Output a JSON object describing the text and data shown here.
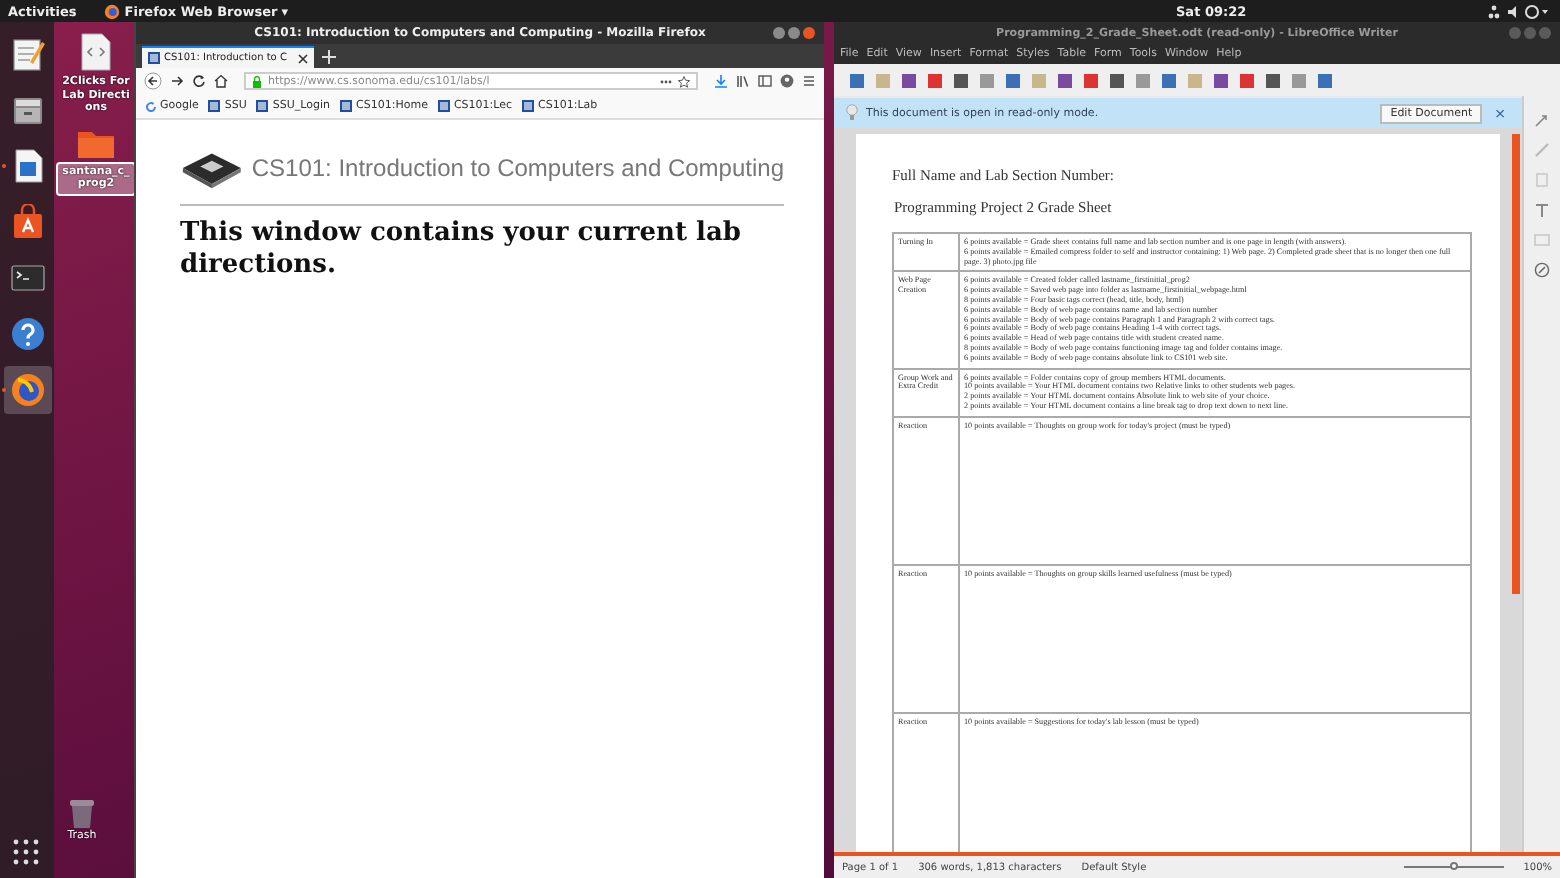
{
  "top_bar": {
    "activities": "Activities",
    "app_menu": "Firefox Web Browser",
    "app_menu_caret": "▾",
    "clock": "Sat 09:22"
  },
  "dock": [
    {
      "kind": "text-editor",
      "running": false,
      "selected": false
    },
    {
      "kind": "files",
      "running": false,
      "selected": false
    },
    {
      "kind": "writer",
      "running": true,
      "selected": false
    },
    {
      "kind": "software",
      "running": false,
      "selected": false
    },
    {
      "kind": "terminal",
      "running": false,
      "selected": false
    },
    {
      "kind": "help",
      "running": false,
      "selected": false
    },
    {
      "kind": "firefox",
      "running": true,
      "selected": true
    }
  ],
  "desktop_icons": [
    {
      "kind": "file",
      "label": "2Clicks For Lab Directions",
      "selected": false
    },
    {
      "kind": "folder",
      "label": "santana_c_prog2",
      "selected": true
    }
  ],
  "trash": {
    "label": "Trash"
  },
  "firefox": {
    "title": "CS101: Introduction to Computers and Computing - Mozilla Firefox",
    "tab": "CS101: Introduction to C",
    "url": "https://www.cs.sonoma.edu/cs101/labs/l",
    "bookmarks": [
      {
        "kind": "google",
        "label": "Google"
      },
      {
        "kind": "site",
        "label": "SSU"
      },
      {
        "kind": "site",
        "label": "SSU_Login"
      },
      {
        "kind": "site",
        "label": "CS101:Home"
      },
      {
        "kind": "site",
        "label": "CS101:Lec"
      },
      {
        "kind": "site",
        "label": "CS101:Lab"
      }
    ],
    "site_title": "CS101: Introduction to Computers and Computing",
    "body": "This window contains your current lab directions."
  },
  "writer": {
    "title": "Programming_2_Grade_Sheet.odt (read-only) - LibreOffice Writer",
    "menu": [
      "File",
      "Edit",
      "View",
      "Insert",
      "Format",
      "Styles",
      "Table",
      "Form",
      "Tools",
      "Window",
      "Help"
    ],
    "infobar": {
      "text": "This document is open in read-only mode.",
      "button": "Edit Document",
      "close": "×"
    },
    "heading": "Full Name and Lab Section Number:",
    "subheading": "Programming Project 2 Grade Sheet",
    "table": [
      {
        "kind": "criteria",
        "label": "Turning In",
        "lines": [
          "6 points available = Grade sheet contains full name and lab section number and is one page in length (with answers).",
          "6 points available = Emailed compress folder to self and instructor containing: 1) Web page. 2) Completed grade sheet that is no longer then one full page. 3) photo.jpg file"
        ]
      },
      {
        "kind": "criteria",
        "label": "Web Page Creation",
        "lines": [
          "6 points available = Created folder called lastname_firstinitial_prog2",
          "6 points available = Saved web page into folder as lastname_firstinitial_webpage.html",
          "8 points available = Four basic tags correct (head, title, body, html)",
          "6 points available = Body of web page contains name and lab section number",
          "6 points available = Body of web page contains Paragraph 1 and Paragraph 2 with correct tags.",
          "6 points available = Body of web page contains Heading 1-4 with correct tags.",
          "6 points available = Head of web page contains title with student created name.",
          "8 points available = Body of web page contains functioning image tag and folder contains image.",
          "6 points available = Body of web page contains absolute link to CS101 web site."
        ]
      },
      {
        "kind": "criteria",
        "label": "Group Work and Extra Credit",
        "lines": [
          "6 points available = Folder contains copy of group members HTML documents.",
          "10 points available = Your HTML document contains two Relative links to other students web pages.",
          "2 points available = Your HTML document contains Absolute link to web site of your choice.",
          "2 points available = Your HTML document contains a line break tag to drop text down to next line."
        ]
      },
      {
        "kind": "answer",
        "label": "Reaction",
        "lines": [
          "10 points available = Thoughts on group work for today's project (must be typed)"
        ]
      },
      {
        "kind": "answer",
        "label": "Reaction",
        "lines": [
          "10 points available = Thoughts on group skills learned usefulness (must be typed)"
        ]
      },
      {
        "kind": "answer",
        "label": "Reaction",
        "lines": [
          "10 points available = Suggestions for today's lab lesson (must be typed)"
        ]
      }
    ],
    "status": {
      "page": "Page 1 of 1",
      "words": "306 words, 1,813 characters",
      "style": "Default Style",
      "zoom": "100%",
      "zoom_slider": {
        "level": 0.5
      }
    }
  }
}
